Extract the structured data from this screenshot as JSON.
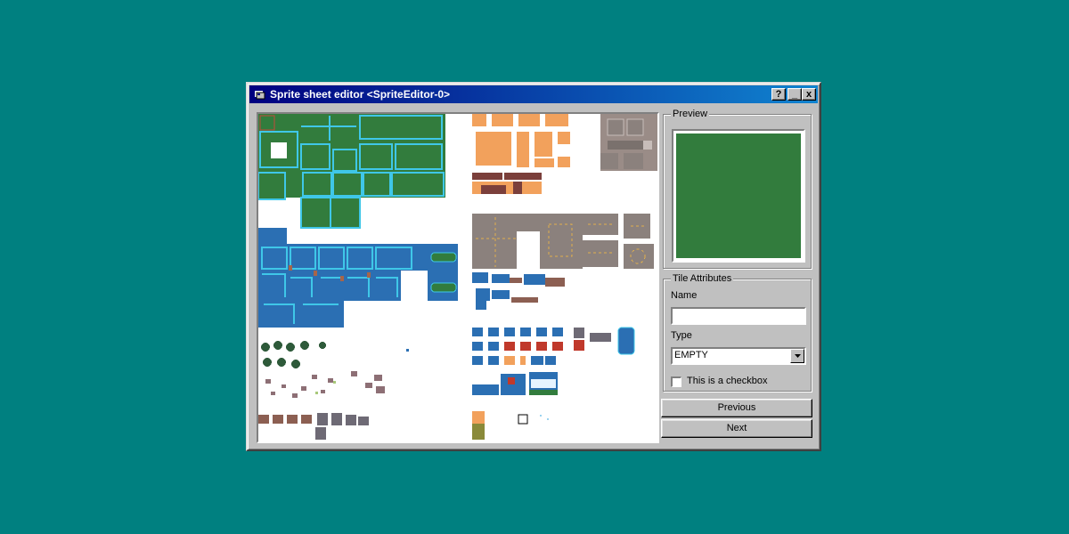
{
  "window": {
    "title": "Sprite sheet editor <SpriteEditor-0>",
    "buttons": {
      "help": "?",
      "minimize": "_",
      "close": "x"
    }
  },
  "preview": {
    "label": "Preview",
    "color": "#327c3d"
  },
  "tile_attributes": {
    "label": "Tile Attributes",
    "name_label": "Name",
    "name_value": "",
    "type_label": "Type",
    "type_value": "EMPTY",
    "checkbox_label": "This is a checkbox",
    "checkbox_checked": false
  },
  "buttons": {
    "previous": "Previous",
    "next": "Next"
  },
  "colors": {
    "desktop": "#008080",
    "grass": "#327c3d",
    "water": "#2b6fb3",
    "sand": "#f2a15c",
    "road": "#8b817d"
  }
}
